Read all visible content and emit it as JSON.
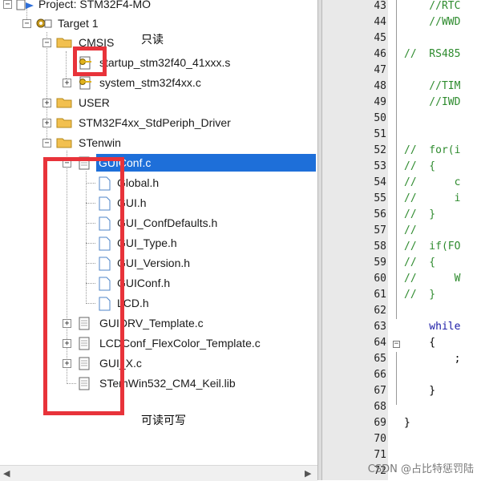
{
  "tree": {
    "project": "Project: STM32F4-MO",
    "target": "Target 1",
    "groups": {
      "cmsis": "CMSIS",
      "user": "USER",
      "stdperiph": "STM32F4xx_StdPeriph_Driver",
      "stenwin": "STenwin"
    },
    "cmsis_files": [
      "startup_stm32f40_41xxx.s",
      "system_stm32f4xx.c"
    ],
    "stenwin_files": {
      "guiconf_c": "GUIConf.c",
      "headers": [
        "Global.h",
        "GUI.h",
        "GUI_ConfDefaults.h",
        "GUI_Type.h",
        "GUI_Version.h",
        "GUIConf.h",
        "LCD.h"
      ],
      "others": [
        "GUIDRV_Template.c",
        "LCDConf_FlexColor_Template.c",
        "GUI_X.c",
        "STemWin532_CM4_Keil.lib"
      ]
    }
  },
  "annotations": {
    "readonly": "只读",
    "readwrite": "可读可写"
  },
  "editor": {
    "lines": [
      {
        "num": "43",
        "text": "    //RTC"
      },
      {
        "num": "44",
        "text": "    //WWD"
      },
      {
        "num": "45",
        "text": ""
      },
      {
        "num": "46",
        "text": "//  RS485"
      },
      {
        "num": "47",
        "text": ""
      },
      {
        "num": "48",
        "text": "    //TIM"
      },
      {
        "num": "49",
        "text": "    //IWD"
      },
      {
        "num": "50",
        "text": ""
      },
      {
        "num": "51",
        "text": ""
      },
      {
        "num": "52",
        "text": "//  for(i"
      },
      {
        "num": "53",
        "text": "//  {"
      },
      {
        "num": "54",
        "text": "//      c"
      },
      {
        "num": "55",
        "text": "//      i"
      },
      {
        "num": "56",
        "text": "//  }"
      },
      {
        "num": "57",
        "text": "//"
      },
      {
        "num": "58",
        "text": "//  if(FO"
      },
      {
        "num": "59",
        "text": "//  {"
      },
      {
        "num": "60",
        "text": "//      W"
      },
      {
        "num": "61",
        "text": "//  }"
      },
      {
        "num": "62",
        "text": ""
      },
      {
        "num": "63",
        "text": "    while"
      },
      {
        "num": "64",
        "text": "    {"
      },
      {
        "num": "65",
        "text": "        ;"
      },
      {
        "num": "66",
        "text": ""
      },
      {
        "num": "67",
        "text": "    }"
      },
      {
        "num": "68",
        "text": ""
      },
      {
        "num": "69",
        "text": "}"
      },
      {
        "num": "70",
        "text": ""
      },
      {
        "num": "71",
        "text": ""
      },
      {
        "num": "72",
        "text": ""
      }
    ]
  },
  "watermark": "CSDN @占比特惩罚陆",
  "colors": {
    "selection": "#1e6fd9",
    "annotation_box": "#e8333a",
    "comment": "#2e8b2e",
    "keyword": "#1a1aa6",
    "gutter": "#e9e9e9"
  }
}
